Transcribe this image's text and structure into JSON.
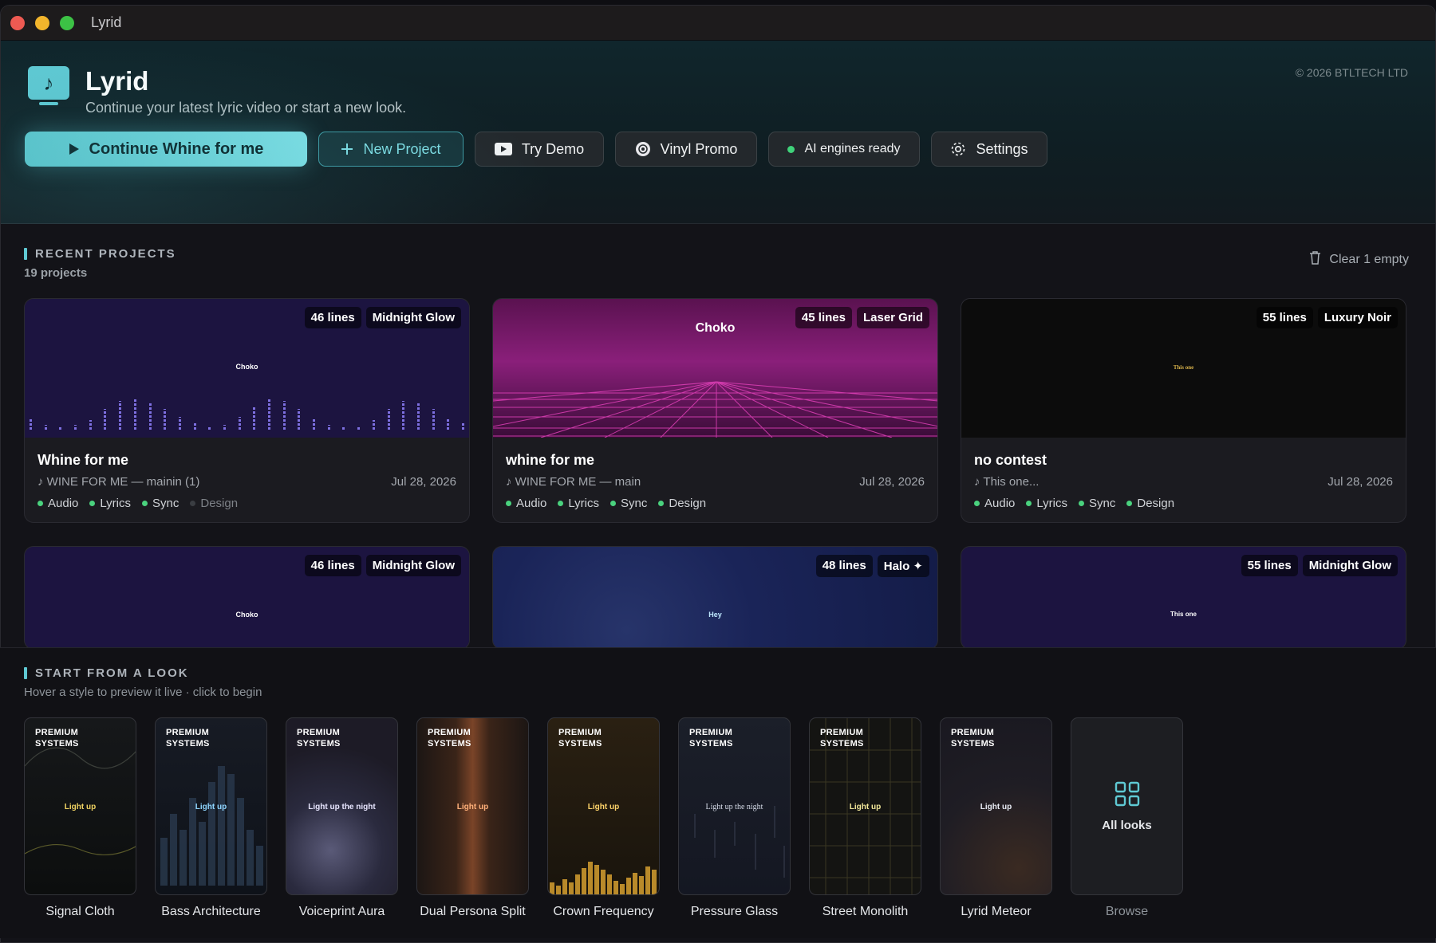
{
  "window": {
    "title": "Lyrid"
  },
  "header": {
    "app_name": "Lyrid",
    "subtitle": "Continue your latest lyric video or start a new look.",
    "copyright": "© 2026 BTLTECH LTD",
    "logo_icon": "music-note-monitor-icon",
    "buttons": {
      "continue": "Continue Whine for me",
      "new_project": "New Project",
      "try_demo": "Try Demo",
      "vinyl_promo": "Vinyl Promo",
      "ai_status": "AI engines ready",
      "settings": "Settings"
    }
  },
  "recent": {
    "title": "RECENT PROJECTS",
    "count": "19 projects",
    "clear": "Clear 1 empty",
    "projects": [
      {
        "lines": "46 lines",
        "style": "Midnight Glow",
        "thumb_text": "Choko",
        "title": "Whine for me",
        "song": "WINE FOR ME — mainin (1)",
        "date": "Jul 28, 2026",
        "steps": [
          "Audio",
          "Lyrics",
          "Sync",
          "Design"
        ],
        "steps_done": [
          true,
          true,
          true,
          false
        ]
      },
      {
        "lines": "45 lines",
        "style": "Laser Grid",
        "thumb_text": "Choko",
        "title": "whine for me",
        "song": "WINE FOR ME — main",
        "date": "Jul 28, 2026",
        "steps": [
          "Audio",
          "Lyrics",
          "Sync",
          "Design"
        ],
        "steps_done": [
          true,
          true,
          true,
          true
        ]
      },
      {
        "lines": "55 lines",
        "style": "Luxury Noir",
        "thumb_text": "This one",
        "title": "no contest",
        "song": "This one...",
        "date": "Jul 28, 2026",
        "steps": [
          "Audio",
          "Lyrics",
          "Sync",
          "Design"
        ],
        "steps_done": [
          true,
          true,
          true,
          true
        ]
      },
      {
        "lines": "46 lines",
        "style": "Midnight Glow",
        "thumb_text": "Choko"
      },
      {
        "lines": "48 lines",
        "style": "Halo ✦",
        "thumb_text": "Hey"
      },
      {
        "lines": "55 lines",
        "style": "Midnight Glow",
        "thumb_text": "This one"
      }
    ]
  },
  "looks": {
    "title": "START FROM A LOOK",
    "subtitle": "Hover a style to preview it live · click to begin",
    "premium_line1": "PREMIUM",
    "premium_line2": "SYSTEMS",
    "items": [
      {
        "name": "Signal Cloth",
        "sample": "Light up"
      },
      {
        "name": "Bass Architecture",
        "sample": "Light up"
      },
      {
        "name": "Voiceprint Aura",
        "sample": "Light up the night"
      },
      {
        "name": "Dual Persona Split",
        "sample": "Light up"
      },
      {
        "name": "Crown Frequency",
        "sample": "Light up"
      },
      {
        "name": "Pressure Glass",
        "sample": "Light up the night"
      },
      {
        "name": "Street Monolith",
        "sample": "Light up"
      },
      {
        "name": "Lyrid Meteor",
        "sample": "Light up"
      }
    ],
    "all_looks": "All looks",
    "browse": "Browse"
  },
  "colors": {
    "accent": "#5fc9d3",
    "status_green": "#3fd27a",
    "laser_pink": "#e040b8",
    "midnight_bar": "#8f80ff"
  }
}
